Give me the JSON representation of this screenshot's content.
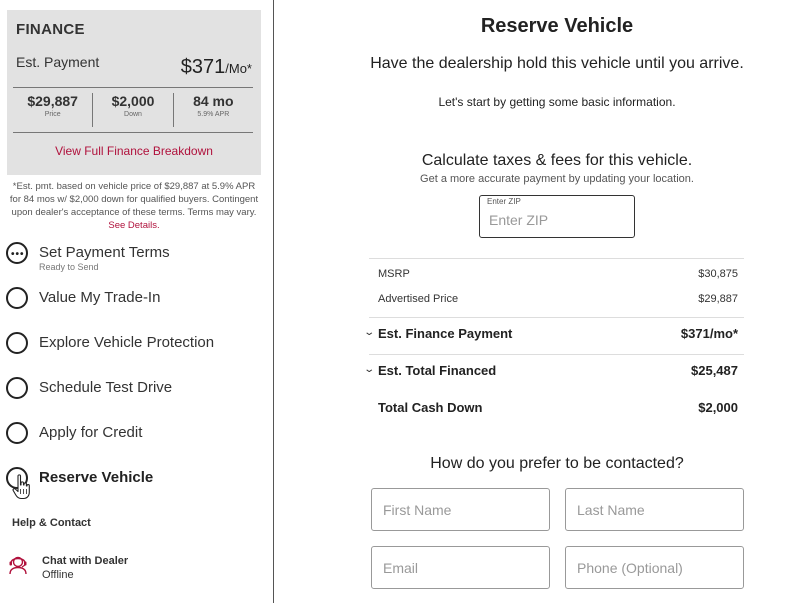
{
  "finance": {
    "title": "FINANCE",
    "est_label": "Est. Payment",
    "est_amount": "$371",
    "est_suffix": "/Mo*",
    "cells": [
      {
        "value": "$29,887",
        "label": "Price"
      },
      {
        "value": "$2,000",
        "label": "Down"
      },
      {
        "value": "84 mo",
        "label": "5.9% APR"
      }
    ],
    "breakdown_link": "View Full Finance Breakdown",
    "disclaimer": "*Est. pmt. based on vehicle price of $29,887 at 5.9% APR for 84 mos w/ $2,000 down for qualified buyers. Contingent upon dealer's acceptance of these terms. Terms may vary.",
    "see_details": "See Details."
  },
  "steps": [
    {
      "label": "Set Payment Terms",
      "sub": "Ready to Send",
      "icon": "dots-circle-icon",
      "active": false
    },
    {
      "label": "Value My Trade-In",
      "sub": "",
      "icon": "empty-circle-icon",
      "active": false
    },
    {
      "label": "Explore Vehicle Protection",
      "sub": "",
      "icon": "empty-circle-icon",
      "active": false
    },
    {
      "label": "Schedule Test Drive",
      "sub": "",
      "icon": "empty-circle-icon",
      "active": false
    },
    {
      "label": "Apply for Credit",
      "sub": "",
      "icon": "empty-circle-icon",
      "active": false
    },
    {
      "label": "Reserve Vehicle",
      "sub": "",
      "icon": "empty-circle-icon",
      "active": true
    }
  ],
  "help": {
    "title": "Help & Contact",
    "chat_name": "Chat with Dealer",
    "chat_status": "Offline",
    "chat_icon": "headset-agent-icon"
  },
  "main": {
    "title": "Reserve Vehicle",
    "intro": "Have the dealership hold this vehicle until you arrive.",
    "sub": "Let's start by getting some basic information.",
    "calc_title": "Calculate taxes & fees for this vehicle.",
    "calc_sub": "Get a more accurate payment by updating your location.",
    "zip_label": "Enter ZIP",
    "zip_placeholder": "Enter ZIP",
    "zip_value": ""
  },
  "pricing": {
    "msrp_label": "MSRP",
    "msrp_value": "$30,875",
    "advertised_label": "Advertised Price",
    "advertised_value": "$29,887",
    "finance_label": "Est. Finance Payment",
    "finance_value": "$371/mo*",
    "total_financed_label": "Est. Total Financed",
    "total_financed_value": "$25,487",
    "cash_down_label": "Total Cash Down",
    "cash_down_value": "$2,000"
  },
  "contact": {
    "title": "How do you prefer to be contacted?",
    "first_name": "First Name",
    "last_name": "Last Name",
    "email": "Email",
    "phone": "Phone (Optional)"
  },
  "colors": {
    "accent": "#b0113c",
    "card_bg": "#e2e2e2"
  }
}
